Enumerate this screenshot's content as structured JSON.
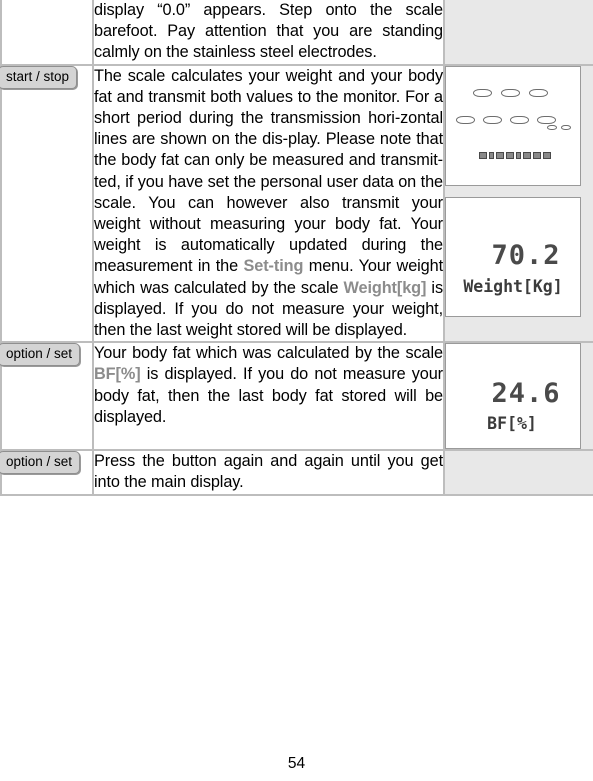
{
  "page": {
    "number": "54"
  },
  "rows": [
    {
      "id": "row-step-on",
      "button": null,
      "text_runs": [
        {
          "t": "display “0.0” appears. Step onto the scale barefoot. Pay attention that you are standing calmly on the stainless steel electrodes.",
          "style": "normal"
        }
      ],
      "display": null
    },
    {
      "id": "row-start-stop",
      "button": "start / stop",
      "text_runs": [
        {
          "t": "The scale calculates your weight and your body fat and transmit both values to the monitor. For a short period during the transmission hori-zontal lines are shown on the dis-play. Please note that the body fat can only be measured and transmit-ted, if you have set the personal user data on the scale. You can however also transmit your weight without measuring your body fat. Your weight is automatically updated during the measurement in the ",
          "style": "normal"
        },
        {
          "t": "Set-ting",
          "style": "highlight"
        },
        {
          "t": " menu. Your weight which was calculated by the scale ",
          "style": "normal"
        },
        {
          "t": "Weight[kg]",
          "style": "highlight"
        },
        {
          "t": " is displayed. If you do not measure your weight, then the last weight stored will be displayed.",
          "style": "normal"
        }
      ],
      "display": "transmission-and-weight"
    },
    {
      "id": "row-body-fat",
      "button": "option / set",
      "text_runs": [
        {
          "t": "Your body fat which was calculated by the scale ",
          "style": "normal"
        },
        {
          "t": "BF[%]",
          "style": "highlight"
        },
        {
          "t": " is displayed. If you do not measure your body fat, then the last body fat stored will be displayed.",
          "style": "normal"
        }
      ],
      "display": "body-fat"
    },
    {
      "id": "row-main-display",
      "button": "option / set",
      "text_runs": [
        {
          "t": "Press the button again and again until you get into the main display.",
          "style": "normal"
        }
      ],
      "display": null
    }
  ],
  "displays": {
    "transmission": {
      "name": "transmission-dashes-screen",
      "top_dashes": 3,
      "mid_dashes": 4,
      "mid_small_dashes": 2,
      "bottom_blocks": 8
    },
    "weight": {
      "name": "weight-screen",
      "value": "70.2",
      "label": "Weight[Kg]"
    },
    "bodyfat": {
      "name": "body-fat-screen",
      "value": "24.6",
      "label": "BF[%]"
    }
  },
  "colors": {
    "highlight": "#8c8c8c",
    "border": "#bdbdbd",
    "display_cell_bg": "#e8e8e8",
    "button_chip_bg": "#d4d4d4",
    "lcd_segment": "#6d6d6d"
  }
}
